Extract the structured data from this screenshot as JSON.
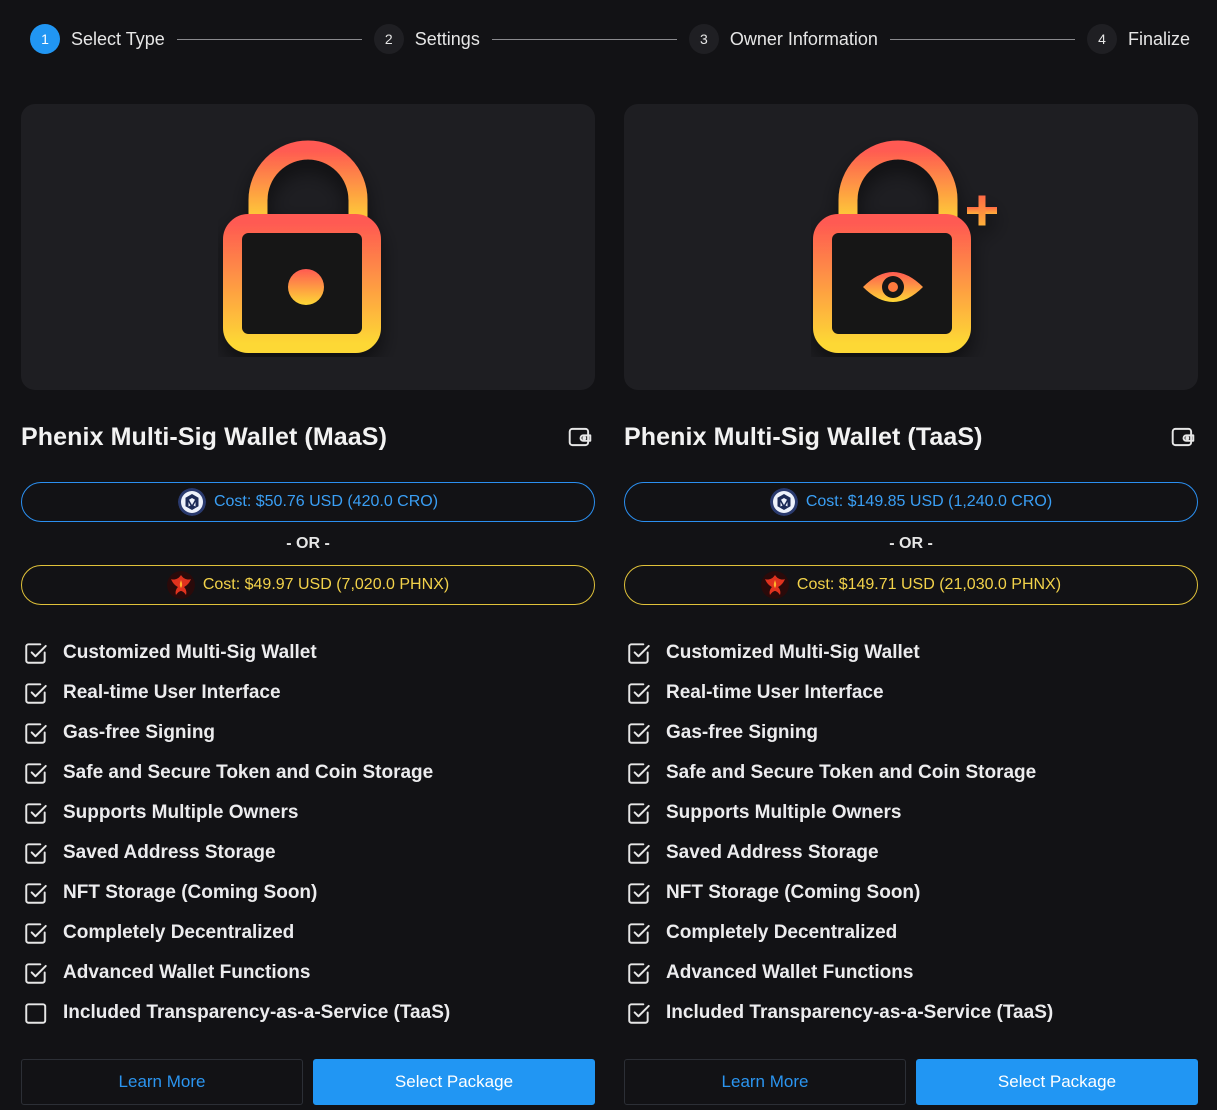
{
  "stepper": {
    "steps": [
      {
        "num": "1",
        "label": "Select Type"
      },
      {
        "num": "2",
        "label": "Settings"
      },
      {
        "num": "3",
        "label": "Owner Information"
      },
      {
        "num": "4",
        "label": "Finalize"
      }
    ],
    "active_step": 1
  },
  "colors": {
    "accent_blue": "#2196f3",
    "gold": "#f2d24a",
    "lock_gradient_top": "#ff5a52",
    "lock_gradient_bottom": "#fdd835"
  },
  "cards": [
    {
      "title": "Phenix Multi-Sig Wallet (MaaS)",
      "icon": "lock-icon",
      "cost_cro": "Cost: $50.76 USD (420.0 CRO)",
      "or_label": "- OR -",
      "cost_phnx": "Cost: $49.97 USD (7,020.0 PHNX)",
      "features": [
        {
          "label": "Customized Multi-Sig Wallet",
          "checked": true
        },
        {
          "label": "Real-time User Interface",
          "checked": true
        },
        {
          "label": "Gas-free Signing",
          "checked": true
        },
        {
          "label": "Safe and Secure Token and Coin Storage",
          "checked": true
        },
        {
          "label": "Supports Multiple Owners",
          "checked": true
        },
        {
          "label": "Saved Address Storage",
          "checked": true
        },
        {
          "label": "NFT Storage (Coming Soon)",
          "checked": true
        },
        {
          "label": "Completely Decentralized",
          "checked": true
        },
        {
          "label": "Advanced Wallet Functions",
          "checked": true
        },
        {
          "label": "Included Transparency-as-a-Service (TaaS)",
          "checked": false
        }
      ],
      "learn_more": "Learn More",
      "select_package": "Select Package"
    },
    {
      "title": "Phenix Multi-Sig Wallet (TaaS)",
      "icon": "lock-eye-plus-icon",
      "cost_cro": "Cost: $149.85 USD (1,240.0 CRO)",
      "or_label": "- OR -",
      "cost_phnx": "Cost: $149.71 USD (21,030.0 PHNX)",
      "features": [
        {
          "label": "Customized Multi-Sig Wallet",
          "checked": true
        },
        {
          "label": "Real-time User Interface",
          "checked": true
        },
        {
          "label": "Gas-free Signing",
          "checked": true
        },
        {
          "label": "Safe and Secure Token and Coin Storage",
          "checked": true
        },
        {
          "label": "Supports Multiple Owners",
          "checked": true
        },
        {
          "label": "Saved Address Storage",
          "checked": true
        },
        {
          "label": "NFT Storage (Coming Soon)",
          "checked": true
        },
        {
          "label": "Completely Decentralized",
          "checked": true
        },
        {
          "label": "Advanced Wallet Functions",
          "checked": true
        },
        {
          "label": "Included Transparency-as-a-Service (TaaS)",
          "checked": true
        }
      ],
      "learn_more": "Learn More",
      "select_package": "Select Package"
    }
  ]
}
